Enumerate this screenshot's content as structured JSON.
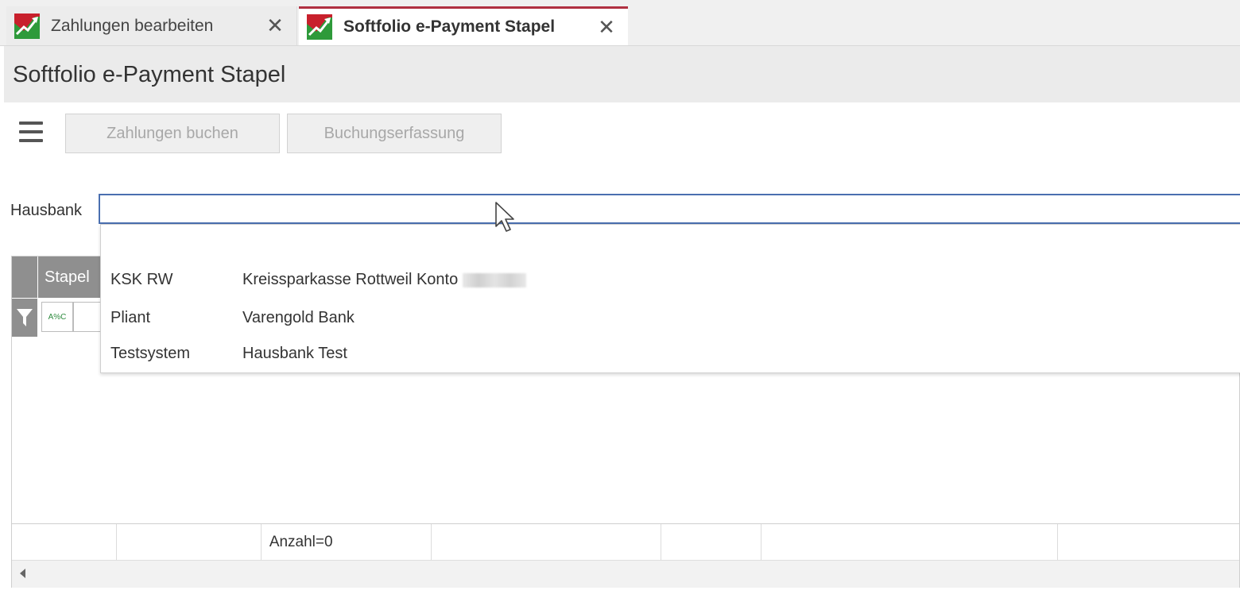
{
  "tabs": [
    {
      "label": "Zahlungen bearbeiten",
      "active": false
    },
    {
      "label": "Softfolio e-Payment Stapel",
      "active": true
    }
  ],
  "page": {
    "title": "Softfolio e-Payment Stapel"
  },
  "toolbar": {
    "menu_icon": "hamburger-icon",
    "buttons": [
      {
        "label": "Zahlungen buchen",
        "enabled": false
      },
      {
        "label": "Buchungserfassung",
        "enabled": false
      }
    ]
  },
  "hausbank": {
    "label": "Hausbank",
    "value": "",
    "options": [
      {
        "code": "KSK RW",
        "name": "Kreissparkasse Rottweil Konto"
      },
      {
        "code": "Pliant",
        "name": "Varengold Bank"
      },
      {
        "code": "Testsystem",
        "name": "Hausbank Test"
      }
    ]
  },
  "grid": {
    "column_header": "Stapel",
    "filter_placeholder": "A%C",
    "footer": {
      "count_text": "Anzahl=0"
    }
  },
  "colors": {
    "active_tab_accent": "#b03040",
    "input_border": "#4a6fb0",
    "grid_header": "#8f8f8f"
  }
}
